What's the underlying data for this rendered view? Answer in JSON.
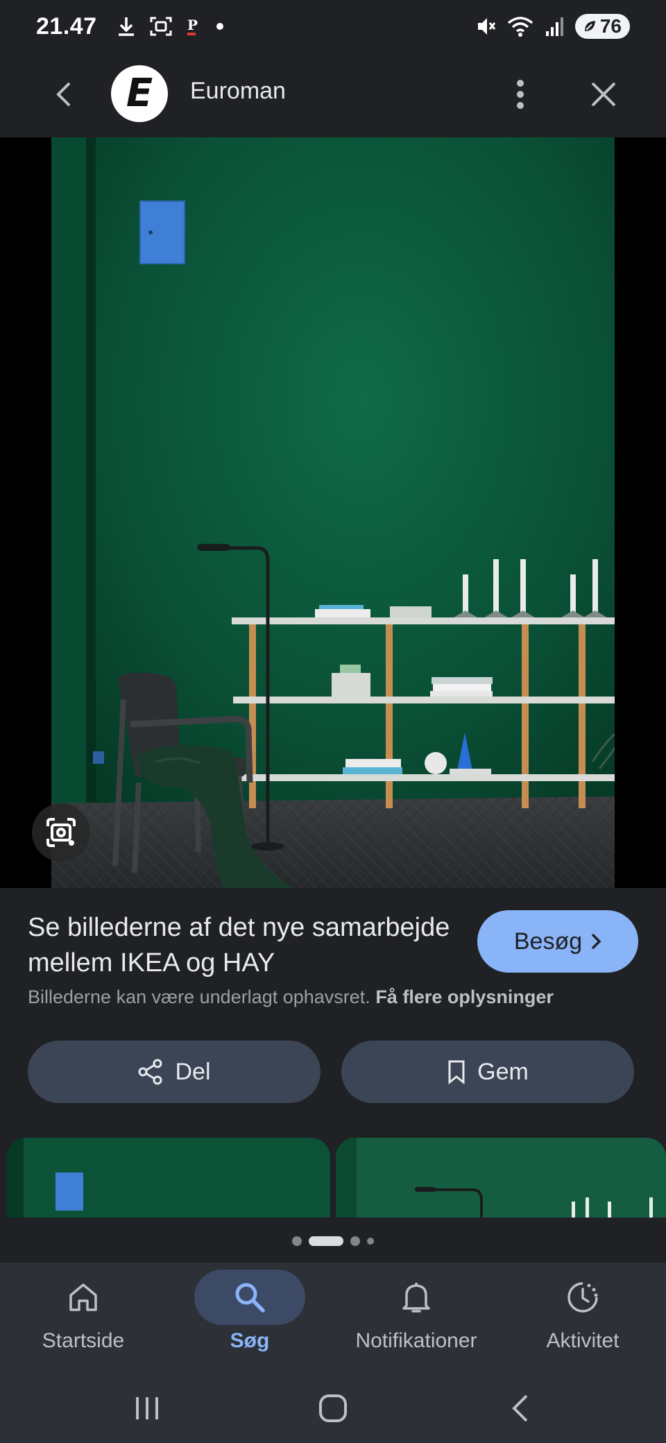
{
  "status_bar": {
    "time": "21.47",
    "battery": "76",
    "icons_left": [
      "download-icon",
      "screenshot-icon",
      "p-app-icon",
      "dot-icon"
    ],
    "icons_right": [
      "mute-icon",
      "wifi-icon",
      "signal-icon",
      "battery-icon"
    ]
  },
  "header": {
    "logo_letter": "E",
    "site_name": "Euroman"
  },
  "result": {
    "title": "Se billederne af det nye samarbejde mellem IKEA og HAY",
    "visit_label": "Besøg",
    "copyright_text": "Billederne kan være underlagt ophavsret.",
    "more_info_link": "Få flere oplysninger",
    "share_label": "Del",
    "save_label": "Gem"
  },
  "pager": {
    "count": 4,
    "active_index": 1
  },
  "bottom_nav": {
    "items": [
      {
        "label": "Startside",
        "icon": "home-icon",
        "active": false
      },
      {
        "label": "Søg",
        "icon": "search-icon",
        "active": true
      },
      {
        "label": "Notifikationer",
        "icon": "bell-icon",
        "active": false
      },
      {
        "label": "Aktivitet",
        "icon": "activity-icon",
        "active": false
      }
    ]
  },
  "colors": {
    "background": "#202124",
    "accent": "#8ab4f8",
    "button_bg": "#3c4555",
    "nav_bg": "#2d3036",
    "wall_green": "#0d5a3d"
  }
}
